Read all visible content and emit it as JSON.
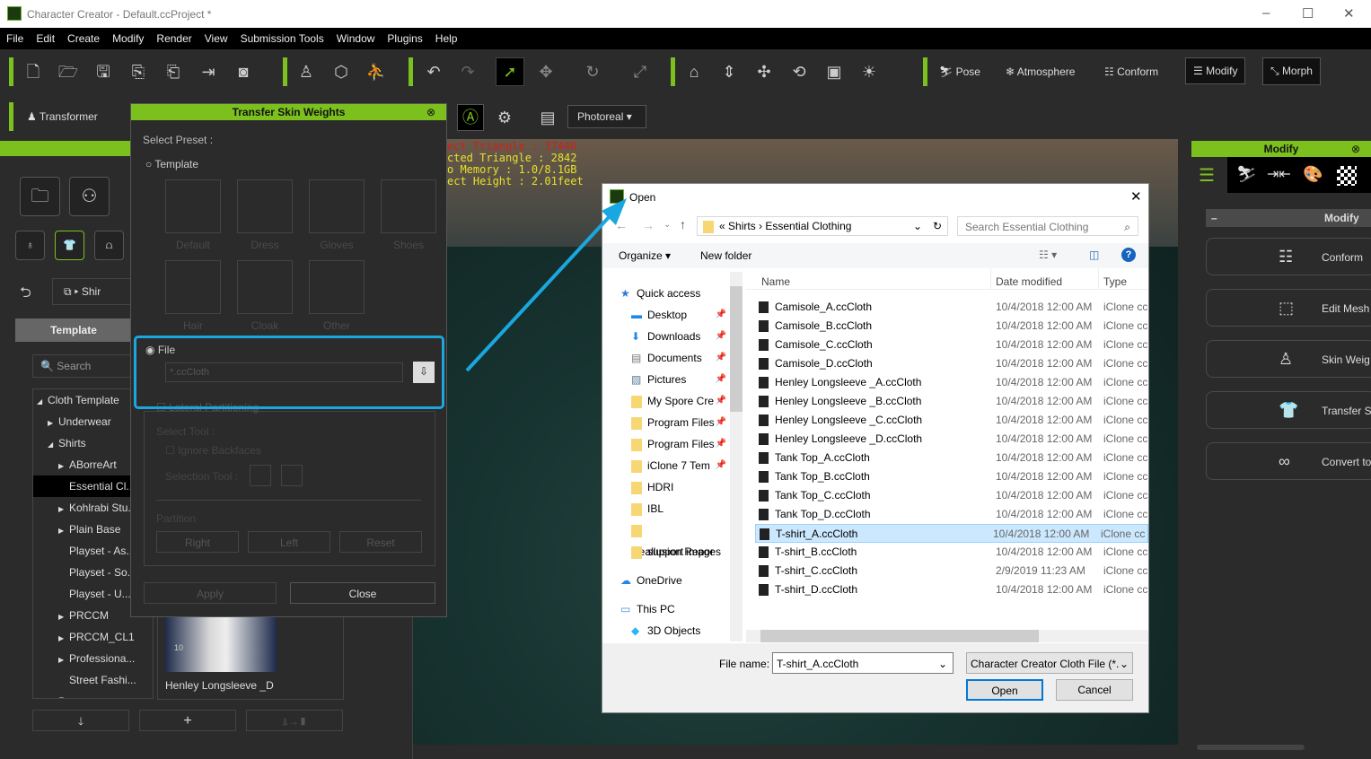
{
  "window": {
    "title": "Character Creator - Default.ccProject *",
    "minimize": "–",
    "maximize": "☐",
    "close": "✕"
  },
  "menu": [
    "File",
    "Edit",
    "Create",
    "Modify",
    "Render",
    "View",
    "Submission Tools",
    "Window",
    "Plugins",
    "Help"
  ],
  "toolbar": {
    "pose": "Pose",
    "atmosphere": "Atmosphere",
    "conform": "Conform",
    "modify": "Modify",
    "morph": "Morph",
    "transformer": "Transformer",
    "render_mode": "Photoreal"
  },
  "left_panel": {
    "breadcrumb": "Shir",
    "tab": "Template",
    "search_placeholder": "Search",
    "tree": [
      {
        "label": "Cloth Template",
        "level": 0,
        "arrow": "◢"
      },
      {
        "label": "Underwear",
        "level": 1,
        "arrow": "▶"
      },
      {
        "label": "Shirts",
        "level": 1,
        "arrow": "◢"
      },
      {
        "label": "ABorreArt",
        "level": 2,
        "arrow": "▶"
      },
      {
        "label": "Essential Cl...",
        "level": 2,
        "arrow": "",
        "selected": true
      },
      {
        "label": "Kohlrabi Stu...",
        "level": 2,
        "arrow": "▶"
      },
      {
        "label": "Plain Base",
        "level": 2,
        "arrow": "▶"
      },
      {
        "label": "Playset - As...",
        "level": 2,
        "arrow": ""
      },
      {
        "label": "Playset - So...",
        "level": 2,
        "arrow": ""
      },
      {
        "label": "Playset - U...",
        "level": 2,
        "arrow": ""
      },
      {
        "label": "PRCCM",
        "level": 2,
        "arrow": "▶"
      },
      {
        "label": "PRCCM_CL1",
        "level": 2,
        "arrow": "▶"
      },
      {
        "label": "Professiona...",
        "level": 2,
        "arrow": "▶"
      },
      {
        "label": "Street Fashi...",
        "level": 2,
        "arrow": ""
      },
      {
        "label": "Pants",
        "level": 1,
        "arrow": "▶"
      }
    ],
    "thumb_label": "Henley Longsleeve _D",
    "thumb_badge": "10"
  },
  "skin_dialog": {
    "title": "Transfer Skin Weights",
    "select_preset": "Select Preset :",
    "template": "Template",
    "presets": [
      "Default",
      "Dress",
      "Gloves",
      "Shoes",
      "Hair",
      "Cloak",
      "Other"
    ],
    "file": "File",
    "file_placeholder": "*.ccCloth",
    "lateral": "Lateral Partitioning",
    "select_tool": "Select Tool :",
    "ignore_backfaces": "Ignore Backfaces",
    "selection_tool": "Selection Tool :",
    "partition": "Partition",
    "right": "Right",
    "left": "Left",
    "reset": "Reset",
    "apply": "Apply",
    "close": "Close"
  },
  "viewport_stats": [
    "ect Triangle : 37440",
    "cted Triangle : 2842",
    "o Memory : 1.0/8.1GB",
    "ect Height : 2.01feet"
  ],
  "right_panel": {
    "title": "Modify",
    "section": "Modify",
    "buttons": [
      "Conform",
      "Edit Mesh",
      "Skin Weig",
      "Transfer S",
      "Convert to"
    ]
  },
  "open_dialog": {
    "title": "Open",
    "path": [
      "Shirts",
      "Essential Clothing"
    ],
    "search_placeholder": "Search Essential Clothing",
    "organize": "Organize ▾",
    "new_folder": "New folder",
    "nav": [
      {
        "label": "Quick access",
        "type": "star"
      },
      {
        "label": "Desktop",
        "type": "desktop",
        "pin": true
      },
      {
        "label": "Downloads",
        "type": "down",
        "pin": true
      },
      {
        "label": "Documents",
        "type": "doc",
        "pin": true
      },
      {
        "label": "Pictures",
        "type": "pic",
        "pin": true
      },
      {
        "label": "My Spore Cre",
        "type": "folder",
        "pin": true
      },
      {
        "label": "Program Files",
        "type": "folder",
        "pin": true
      },
      {
        "label": "Program Files",
        "type": "folder",
        "pin": true
      },
      {
        "label": "iClone 7 Tem",
        "type": "folder",
        "pin": true
      },
      {
        "label": "HDRI",
        "type": "folder"
      },
      {
        "label": "IBL",
        "type": "folder"
      },
      {
        "label": "Reallusion Repor",
        "type": "folder"
      },
      {
        "label": "support images",
        "type": "folder"
      },
      {
        "label": "OneDrive",
        "type": "cloud"
      },
      {
        "label": "This PC",
        "type": "pc"
      },
      {
        "label": "3D Objects",
        "type": "cube"
      }
    ],
    "columns": [
      "Name",
      "Date modified",
      "Type"
    ],
    "files": [
      [
        "Camisole_A.ccCloth",
        "10/4/2018 12:00 AM",
        "iClone cc"
      ],
      [
        "Camisole_B.ccCloth",
        "10/4/2018 12:00 AM",
        "iClone cc"
      ],
      [
        "Camisole_C.ccCloth",
        "10/4/2018 12:00 AM",
        "iClone cc"
      ],
      [
        "Camisole_D.ccCloth",
        "10/4/2018 12:00 AM",
        "iClone cc"
      ],
      [
        "Henley Longsleeve _A.ccCloth",
        "10/4/2018 12:00 AM",
        "iClone cc"
      ],
      [
        "Henley Longsleeve _B.ccCloth",
        "10/4/2018 12:00 AM",
        "iClone cc"
      ],
      [
        "Henley Longsleeve _C.ccCloth",
        "10/4/2018 12:00 AM",
        "iClone cc"
      ],
      [
        "Henley Longsleeve _D.ccCloth",
        "10/4/2018 12:00 AM",
        "iClone cc"
      ],
      [
        "Tank Top_A.ccCloth",
        "10/4/2018 12:00 AM",
        "iClone cc"
      ],
      [
        "Tank Top_B.ccCloth",
        "10/4/2018 12:00 AM",
        "iClone cc"
      ],
      [
        "Tank Top_C.ccCloth",
        "10/4/2018 12:00 AM",
        "iClone cc"
      ],
      [
        "Tank Top_D.ccCloth",
        "10/4/2018 12:00 AM",
        "iClone cc"
      ],
      [
        "T-shirt_A.ccCloth",
        "10/4/2018 12:00 AM",
        "iClone cc"
      ],
      [
        "T-shirt_B.ccCloth",
        "10/4/2018 12:00 AM",
        "iClone cc"
      ],
      [
        "T-shirt_C.ccCloth",
        "2/9/2019 11:23 AM",
        "iClone cc"
      ],
      [
        "T-shirt_D.ccCloth",
        "10/4/2018 12:00 AM",
        "iClone cc"
      ]
    ],
    "selected_index": 12,
    "file_name_label": "File name:",
    "file_name": "T-shirt_A.ccCloth",
    "file_type": "Character Creator Cloth File (*.i",
    "open": "Open",
    "cancel": "Cancel"
  },
  "colors": {
    "accent_green": "#7cc01e",
    "highlight_blue": "#1aa7e0",
    "selection": "#cce8ff"
  }
}
